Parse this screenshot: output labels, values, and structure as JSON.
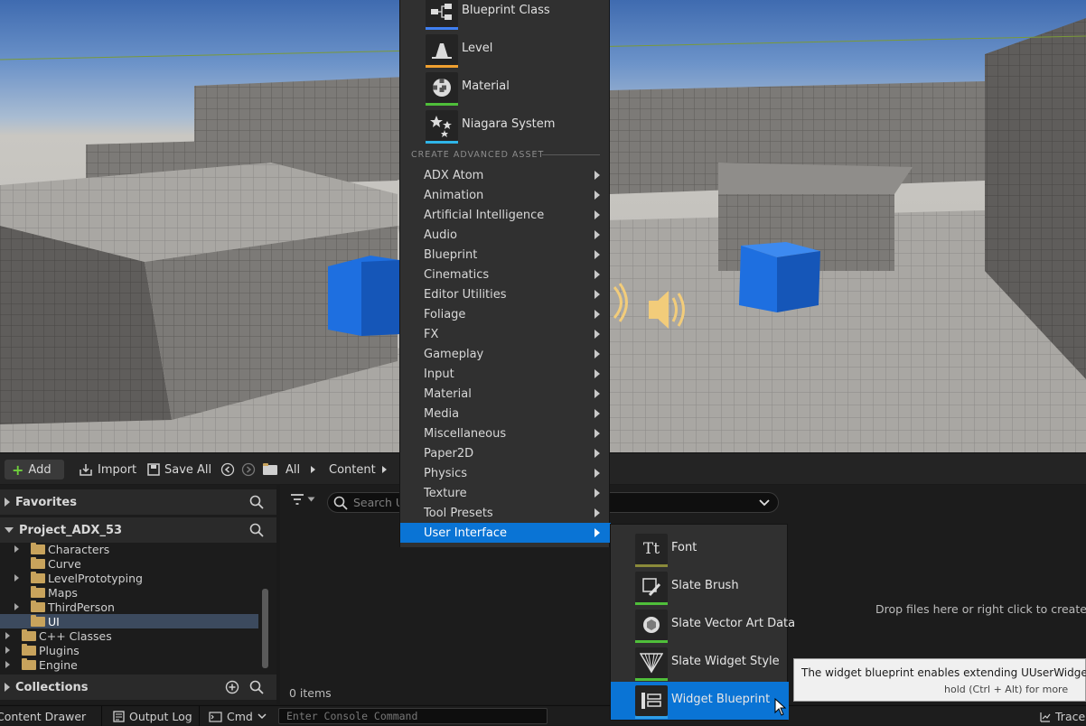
{
  "toolbar": {
    "add_label": "Add",
    "import_label": "Import",
    "save_all_label": "Save All",
    "path": [
      "All",
      "Content"
    ]
  },
  "favorites": {
    "label": "Favorites"
  },
  "project": {
    "label": "Project_ADX_53",
    "tree": [
      {
        "label": "Characters"
      },
      {
        "label": "Curve"
      },
      {
        "label": "LevelPrototyping"
      },
      {
        "label": "Maps"
      },
      {
        "label": "ThirdPerson"
      },
      {
        "label": "UI"
      },
      {
        "label": "C++ Classes"
      },
      {
        "label": "Plugins"
      },
      {
        "label": "Engine"
      }
    ]
  },
  "collections": {
    "label": "Collections"
  },
  "content": {
    "search_placeholder": "Search UI",
    "items_count": "0 items",
    "drop_hint": "Drop files here or right click to create con"
  },
  "bottom_bar": {
    "content_drawer": "Content Drawer",
    "output_log": "Output Log",
    "cmd": "Cmd",
    "console_placeholder": "Enter Console Command",
    "trace": "Trace"
  },
  "menu": {
    "basic_assets": [
      {
        "label": "Blueprint Class",
        "color": "#3f7ff0"
      },
      {
        "label": "Level",
        "color": "#f0a030"
      },
      {
        "label": "Material",
        "color": "#4fbf3a"
      },
      {
        "label": "Niagara System",
        "color": "#2fb5e8"
      }
    ],
    "advanced_title": "CREATE ADVANCED ASSET",
    "advanced_items": [
      {
        "label": "ADX Atom"
      },
      {
        "label": "Animation"
      },
      {
        "label": "Artificial Intelligence"
      },
      {
        "label": "Audio"
      },
      {
        "label": "Blueprint"
      },
      {
        "label": "Cinematics"
      },
      {
        "label": "Editor Utilities"
      },
      {
        "label": "Foliage"
      },
      {
        "label": "FX"
      },
      {
        "label": "Gameplay"
      },
      {
        "label": "Input"
      },
      {
        "label": "Material"
      },
      {
        "label": "Media"
      },
      {
        "label": "Miscellaneous"
      },
      {
        "label": "Paper2D"
      },
      {
        "label": "Physics"
      },
      {
        "label": "Texture"
      },
      {
        "label": "Tool Presets"
      },
      {
        "label": "User Interface"
      }
    ]
  },
  "submenu": {
    "items": [
      {
        "label": "Font",
        "color": "#8a8a3a"
      },
      {
        "label": "Slate Brush",
        "color": "#4fbf3a"
      },
      {
        "label": "Slate Vector Art Data",
        "color": "#4fbf3a"
      },
      {
        "label": "Slate Widget Style",
        "color": "#4fbf3a"
      },
      {
        "label": "Widget Blueprint",
        "color": "#2f9ee8"
      }
    ]
  },
  "tooltip": {
    "text": "The widget blueprint enables extending UUserWidget the us",
    "hint": "hold (Ctrl + Alt) for more"
  },
  "colors": {
    "accent_blue": "#0a74d5",
    "folder": "#c8a35c",
    "add_green": "#6fcf3c"
  }
}
